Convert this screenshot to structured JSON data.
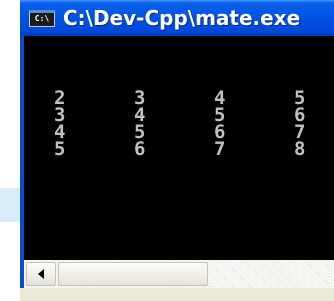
{
  "window": {
    "title": "C:\\Dev-Cpp\\mate.exe",
    "icon_text": "C:\\",
    "icon_name": "console-icon"
  },
  "console": {
    "rows": [
      [
        "2",
        "3",
        "4",
        "5"
      ],
      [
        "3",
        "4",
        "5",
        "6"
      ],
      [
        "4",
        "5",
        "6",
        "7"
      ],
      [
        "5",
        "6",
        "7",
        "8"
      ]
    ],
    "text_color": "#c0c0c0",
    "background": "#000000"
  },
  "scrollbar": {
    "left_arrow_icon": "scroll-left-arrow-icon"
  }
}
